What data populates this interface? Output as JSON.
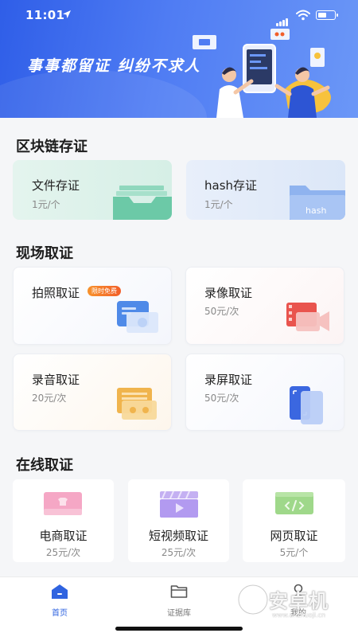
{
  "status_bar": {
    "time": "11:01"
  },
  "banner": {
    "slogan": "事事都留证  纠纷不求人"
  },
  "sections": {
    "blockchain": {
      "title": "区块链存证",
      "file": {
        "name": "文件存证",
        "price": "1元/个"
      },
      "hash": {
        "name": "hash存证",
        "price": "1元/个",
        "folder_label": "hash"
      }
    },
    "onsite": {
      "title": "现场取证",
      "photo": {
        "name": "拍照取证",
        "badge": "限时免费"
      },
      "video": {
        "name": "录像取证",
        "price": "50元/次"
      },
      "audio": {
        "name": "录音取证",
        "price": "20元/次"
      },
      "screen": {
        "name": "录屏取证",
        "price": "50元/次"
      }
    },
    "online": {
      "title": "在线取证",
      "ecommerce": {
        "name": "电商取证",
        "price": "25元/次"
      },
      "short_video": {
        "name": "短视频取证",
        "price": "25元/次"
      },
      "webpage": {
        "name": "网页取证",
        "price": "5元/个"
      }
    }
  },
  "tabbar": {
    "home": "首页",
    "evidence": "证据库",
    "mine": "我的"
  },
  "watermark": {
    "text": "安卓机",
    "url": "www.anzhuoji.cn"
  },
  "colors": {
    "primary": "#2f63e0",
    "badge": "#f25f2a"
  }
}
